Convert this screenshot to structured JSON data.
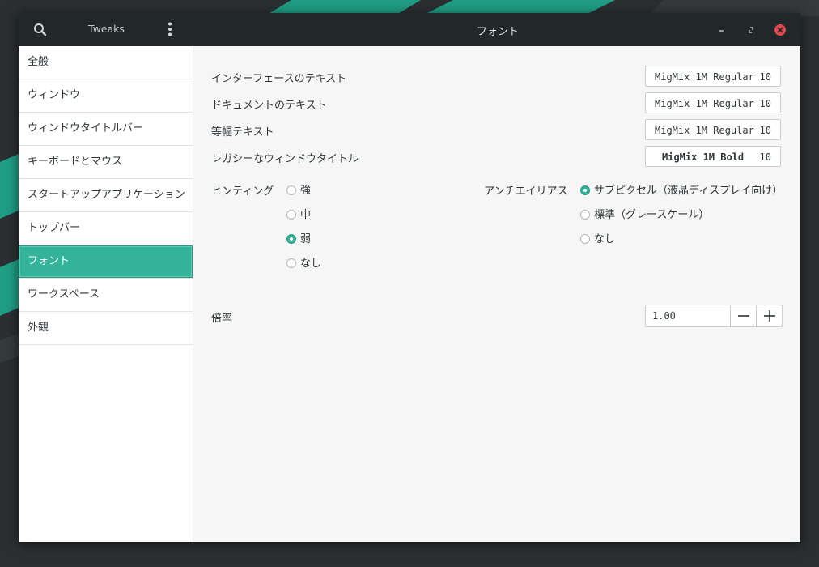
{
  "colors": {
    "accent": "#33b39a",
    "headerbar": "#22282a",
    "close_button": "#e0474c"
  },
  "headerbar": {
    "app_name": "Tweaks",
    "title": "フォント"
  },
  "sidebar": {
    "items": [
      {
        "label": "全般"
      },
      {
        "label": "ウィンドウ"
      },
      {
        "label": "ウィンドウタイトルバー"
      },
      {
        "label": "キーボードとマウス"
      },
      {
        "label": "スタートアップアプリケーション"
      },
      {
        "label": "トップバー"
      },
      {
        "label": "フォント",
        "selected": true
      },
      {
        "label": "ワークスペース"
      },
      {
        "label": "外観"
      }
    ]
  },
  "fonts": {
    "rows": [
      {
        "label": "インターフェースのテキスト",
        "font": "MigMix 1M Regular",
        "size": "10"
      },
      {
        "label": "ドキュメントのテキスト",
        "font": "MigMix 1M Regular",
        "size": "10"
      },
      {
        "label": "等幅テキスト",
        "font": "MigMix 1M Regular",
        "size": "10"
      },
      {
        "label": "レガシーなウィンドウタイトル",
        "font": "MigMix 1M Bold",
        "size": "10"
      }
    ]
  },
  "hinting": {
    "label": "ヒンティング",
    "options": [
      {
        "label": "強",
        "selected": false
      },
      {
        "label": "中",
        "selected": false
      },
      {
        "label": "弱",
        "selected": true
      },
      {
        "label": "なし",
        "selected": false
      }
    ]
  },
  "antialiasing": {
    "label": "アンチエイリアス",
    "options": [
      {
        "label": "サブピクセル（液晶ディスプレイ向け）",
        "selected": true
      },
      {
        "label": "標準（グレースケール）",
        "selected": false
      },
      {
        "label": "なし",
        "selected": false
      }
    ]
  },
  "scaling": {
    "label": "倍率",
    "value": "1.00"
  },
  "icons": {
    "search": "search-icon",
    "menu": "vertical-dots-icon",
    "minimize": "minimize-icon",
    "maximize": "maximize-icon",
    "close": "close-icon",
    "minus": "minus-icon",
    "plus": "plus-icon"
  }
}
